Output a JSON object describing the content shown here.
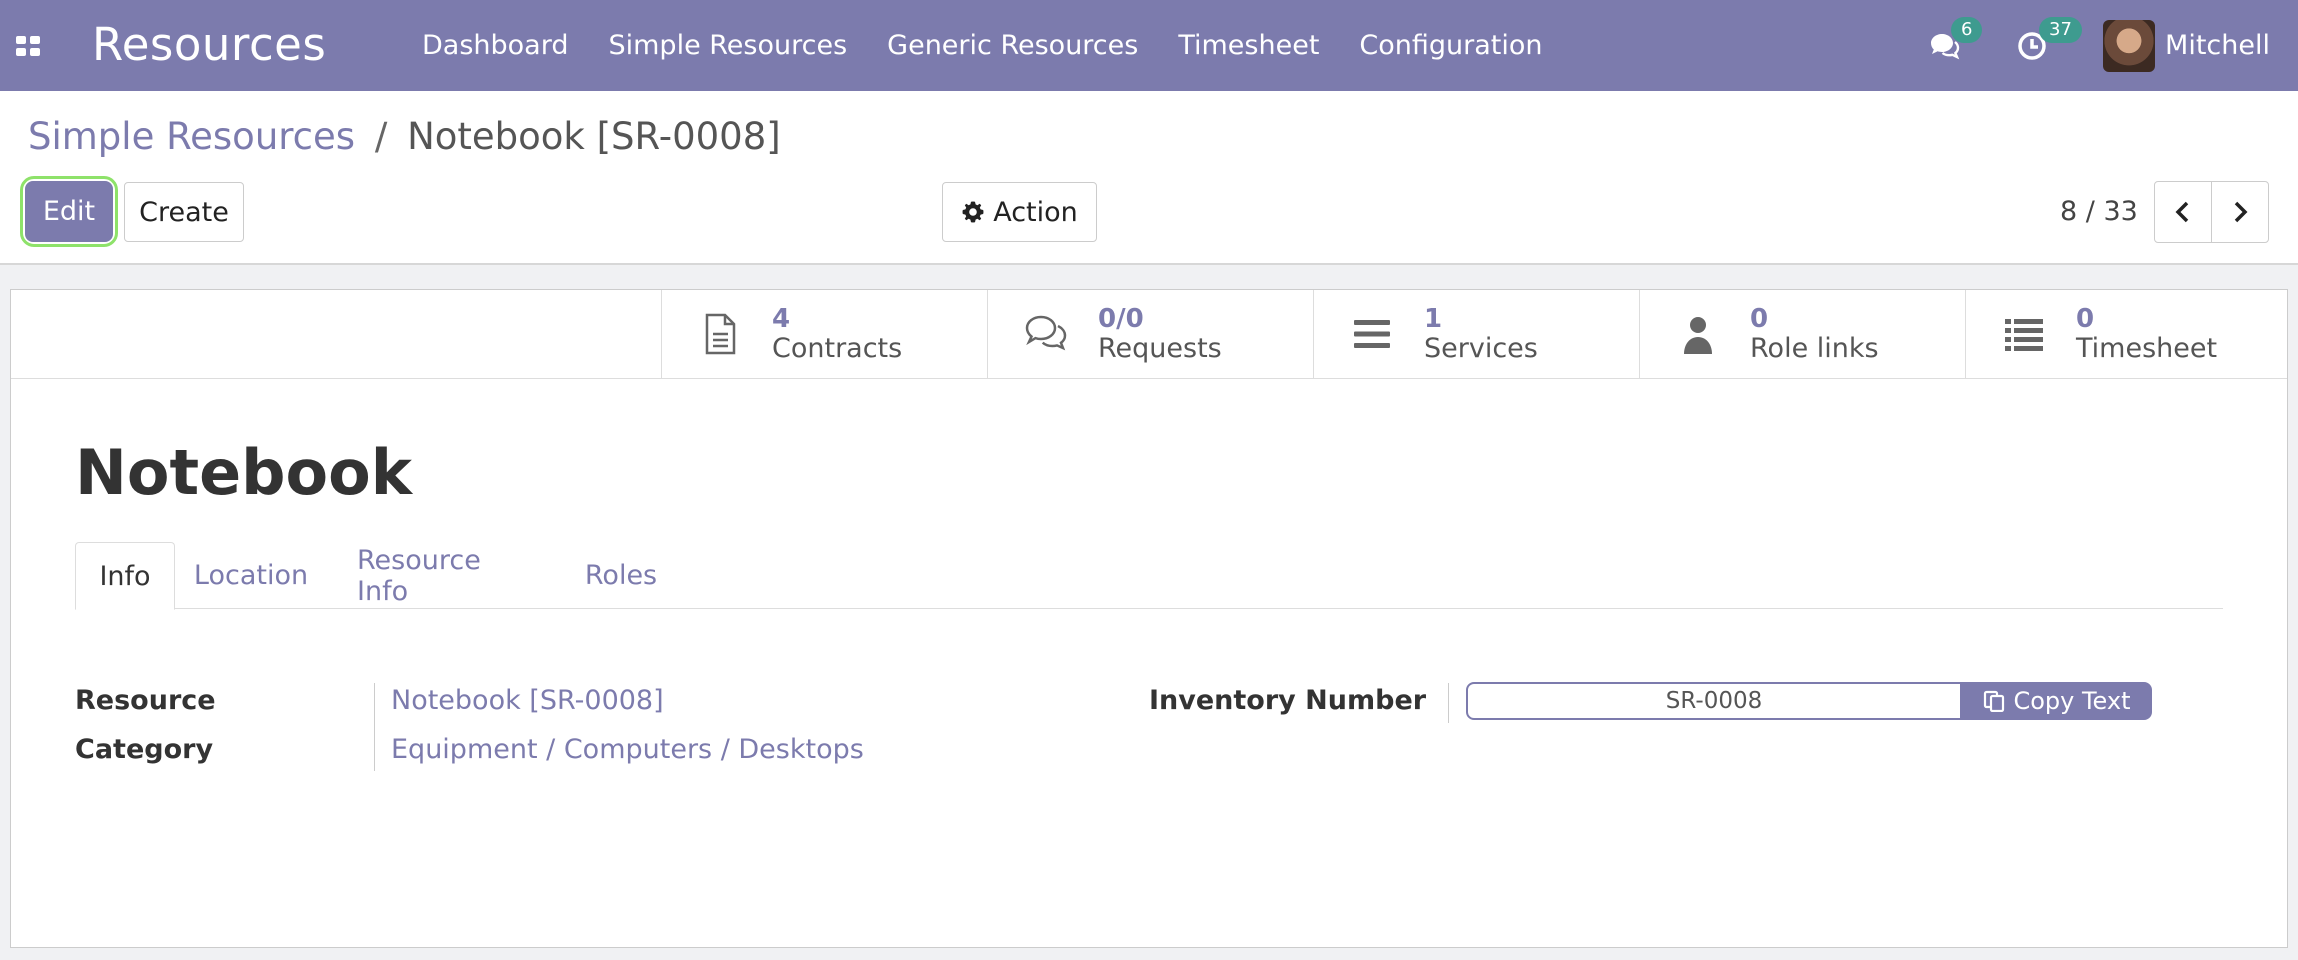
{
  "navbar": {
    "app_title": "Resources",
    "menu": [
      "Dashboard",
      "Simple Resources",
      "Generic Resources",
      "Timesheet",
      "Configuration"
    ],
    "messages_count": "6",
    "activities_count": "37",
    "user_name": "Mitchell"
  },
  "breadcrumb": {
    "parent": "Simple Resources",
    "separator": "/",
    "current": "Notebook [SR-0008]"
  },
  "toolbar": {
    "edit_label": "Edit",
    "create_label": "Create",
    "action_label": "Action"
  },
  "pager": {
    "text": "8 / 33"
  },
  "stats": [
    {
      "value": "4",
      "label": "Contracts"
    },
    {
      "value": "0/0",
      "label": "Requests"
    },
    {
      "value": "1",
      "label": "Services"
    },
    {
      "value": "0",
      "label": "Role links"
    },
    {
      "value": "0",
      "label": "Timesheet"
    }
  ],
  "record": {
    "title": "Notebook"
  },
  "tabs": [
    "Info",
    "Location",
    "Resource Info",
    "Roles"
  ],
  "fields": {
    "resource_label": "Resource",
    "resource_value": "Notebook [SR-0008]",
    "category_label": "Category",
    "category_value": "Equipment / Computers / Desktops",
    "inventory_label": "Inventory Number",
    "inventory_value": "SR-0008",
    "copy_label": "Copy Text"
  },
  "colors": {
    "brand": "#7c7bad",
    "badge": "#3e9b8f",
    "focus_ring": "#8ee26a"
  }
}
